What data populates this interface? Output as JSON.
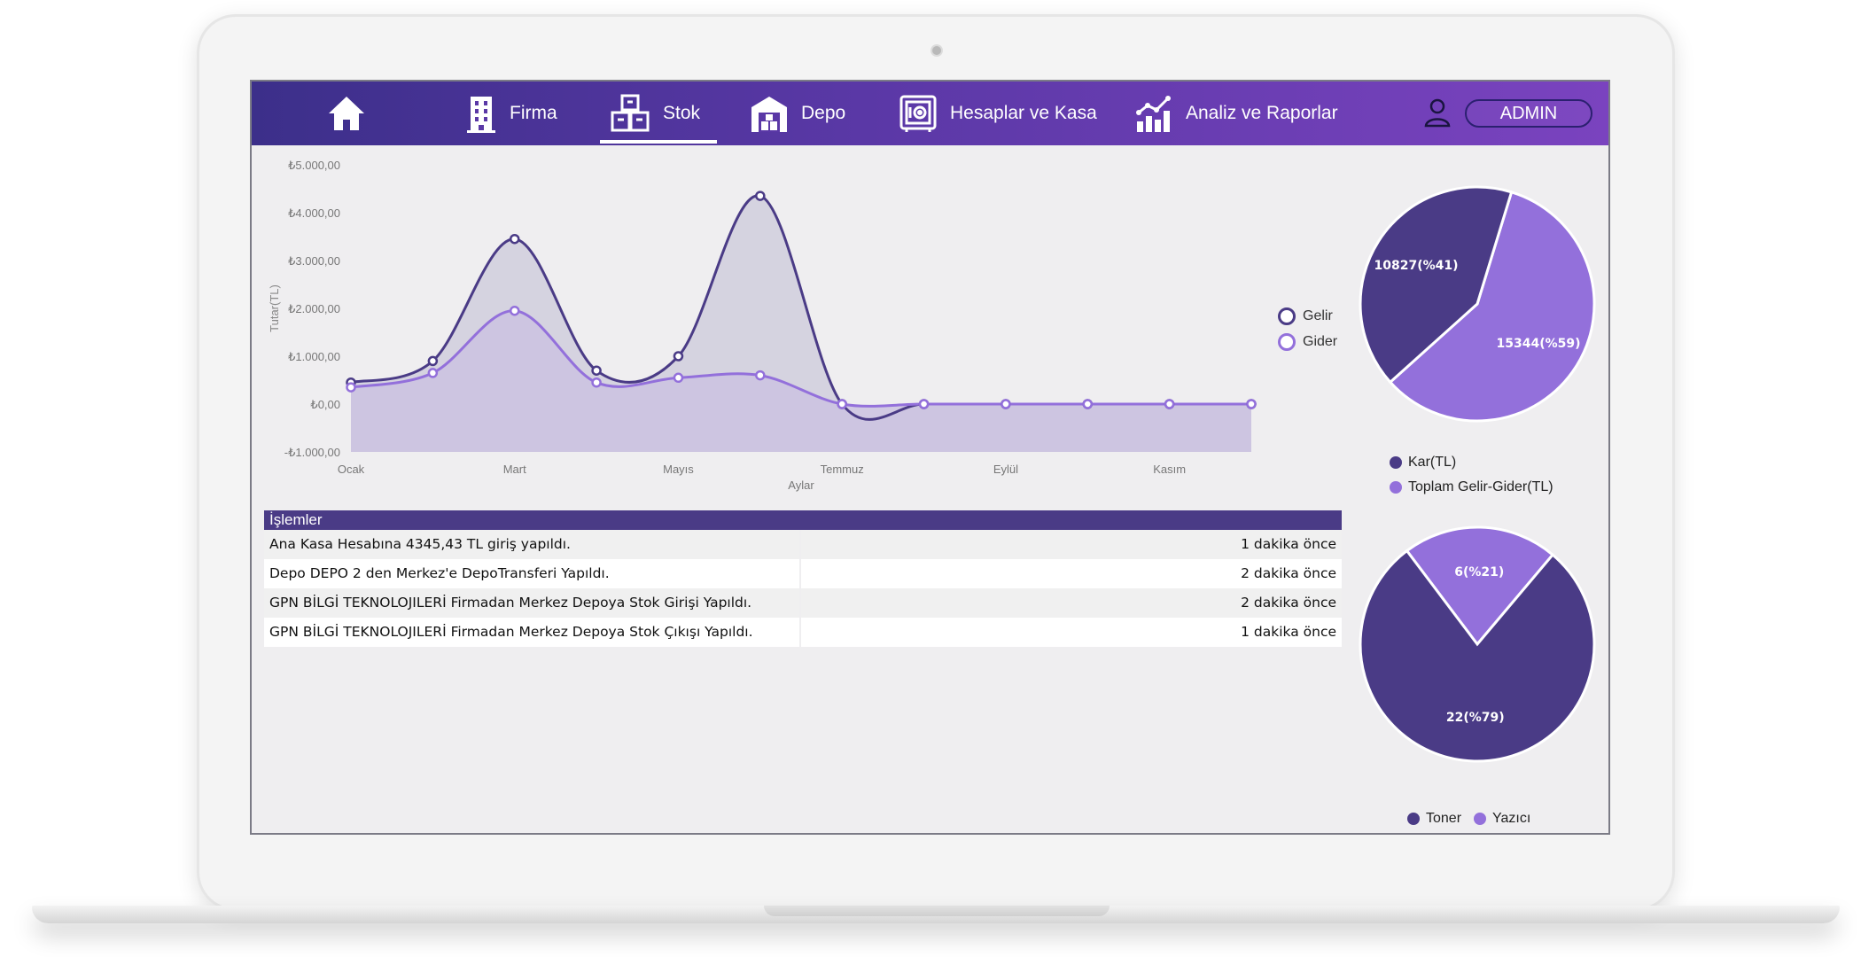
{
  "nav": {
    "items": [
      {
        "label": "",
        "icon": "home-icon"
      },
      {
        "label": "Firma",
        "icon": "building-icon"
      },
      {
        "label": "Stok",
        "icon": "boxes-icon"
      },
      {
        "label": "Depo",
        "icon": "warehouse-icon"
      },
      {
        "label": "Hesaplar ve Kasa",
        "icon": "safe-icon"
      },
      {
        "label": "Analiz ve Raporlar",
        "icon": "analytics-icon"
      }
    ],
    "active": "Stok",
    "admin_label": "ADMIN"
  },
  "colors": {
    "nav_start": "#3c2f8a",
    "nav_end": "#7a43bf",
    "gelir": "#4a3b86",
    "gider": "#9370db",
    "area_gelir": "#d3d1de",
    "area_gider": "#cbc2e1",
    "ops_header": "#4a3b86"
  },
  "chart_data": [
    {
      "type": "area",
      "ylabel": "Tutar(TL)",
      "xlabel": "Aylar",
      "ylim": [
        -1000,
        5000
      ],
      "yticks": [
        "-₺1.000,00",
        "₺0,00",
        "₺1.000,00",
        "₺2.000,00",
        "₺3.000,00",
        "₺4.000,00",
        "₺5.000,00"
      ],
      "ytick_values": [
        -1000,
        0,
        1000,
        2000,
        3000,
        4000,
        5000
      ],
      "xtick_labels": [
        "Ocak",
        "Mart",
        "Mayıs",
        "Temmuz",
        "Eylül",
        "Kasım"
      ],
      "xtick_indices": [
        0,
        2,
        4,
        6,
        8,
        10
      ],
      "x": [
        1,
        2,
        3,
        4,
        5,
        6,
        7,
        8,
        9,
        10,
        11,
        12
      ],
      "series": [
        {
          "name": "Gelir",
          "values": [
            450,
            900,
            3450,
            700,
            1000,
            4350,
            0,
            0,
            0,
            0,
            0,
            0
          ]
        },
        {
          "name": "Gider",
          "values": [
            350,
            650,
            1950,
            450,
            550,
            600,
            0,
            0,
            0,
            0,
            0,
            0
          ]
        }
      ],
      "legend": "right"
    },
    {
      "type": "pie",
      "slices": [
        {
          "label": "Toplam Gelir-Gider(TL)",
          "value": 15344,
          "text": "15344(%59)"
        },
        {
          "label": "Kar(TL)",
          "value": 10827,
          "text": "10827(%41)"
        }
      ],
      "legend": [
        "Kar(TL)",
        "Toplam Gelir-Gider(TL)"
      ]
    },
    {
      "type": "pie",
      "slices": [
        {
          "label": "Yazıcı",
          "value": 6,
          "text": "6(%21)"
        },
        {
          "label": "Toner",
          "value": 22,
          "text": "22(%79)"
        }
      ],
      "legend": [
        "Toner",
        "Yazıcı"
      ]
    }
  ],
  "operations": {
    "title": "İşlemler",
    "rows": [
      {
        "text": "Ana Kasa Hesabına 4345,43 TL giriş yapıldı.",
        "time": "1  dakika önce"
      },
      {
        "text": "Depo DEPO 2 den Merkez'e DepoTransferi Yapıldı.",
        "time": "2  dakika önce"
      },
      {
        "text": "GPN BİLGİ TEKNOLOJILERİ Firmadan Merkez Depoya Stok Girişi Yapıldı.",
        "time": "2  dakika önce"
      },
      {
        "text": "GPN BİLGİ TEKNOLOJILERİ Firmadan Merkez Depoya Stok Çıkışı Yapıldı.",
        "time": "1  dakika önce"
      }
    ]
  }
}
